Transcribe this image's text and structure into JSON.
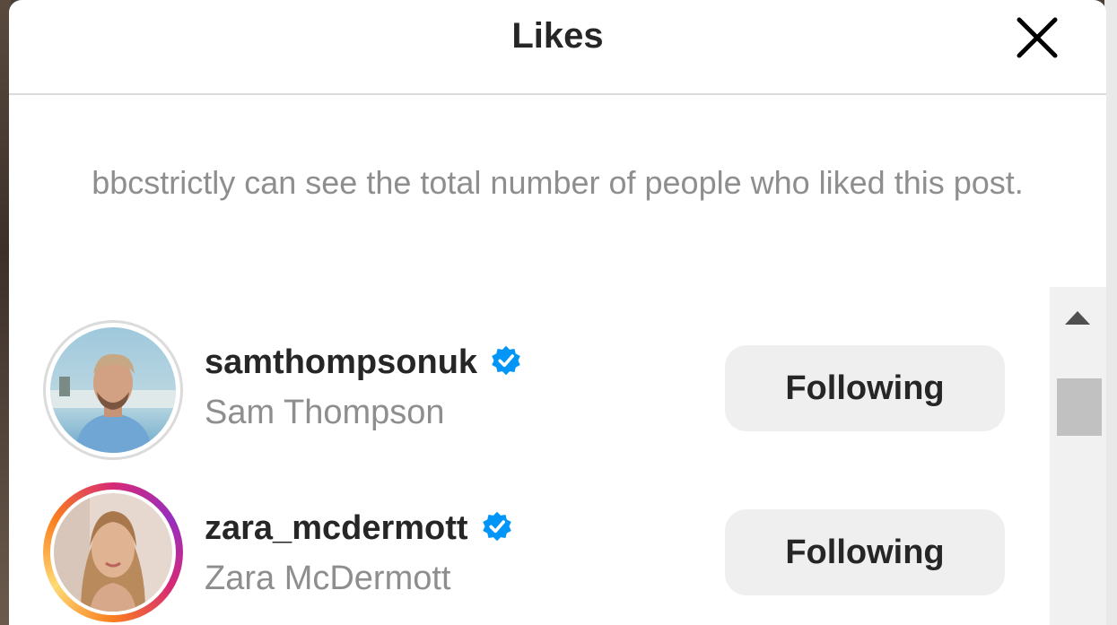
{
  "dialog": {
    "title": "Likes",
    "notice": "bbcstrictly can see the total number of people who liked this post."
  },
  "icons": {
    "close": "close-icon",
    "verified": "verified-badge-icon",
    "scroll_up": "scroll-up-arrow-icon"
  },
  "colors": {
    "verified_blue": "#0095f6",
    "button_bg": "#efefef",
    "secondary_text": "#8e8e8e"
  },
  "likes": [
    {
      "username": "samthompsonuk",
      "full_name": "Sam Thompson",
      "verified": true,
      "has_story": false,
      "button_label": "Following"
    },
    {
      "username": "zara_mcdermott",
      "full_name": "Zara McDermott",
      "verified": true,
      "has_story": true,
      "button_label": "Following"
    }
  ]
}
